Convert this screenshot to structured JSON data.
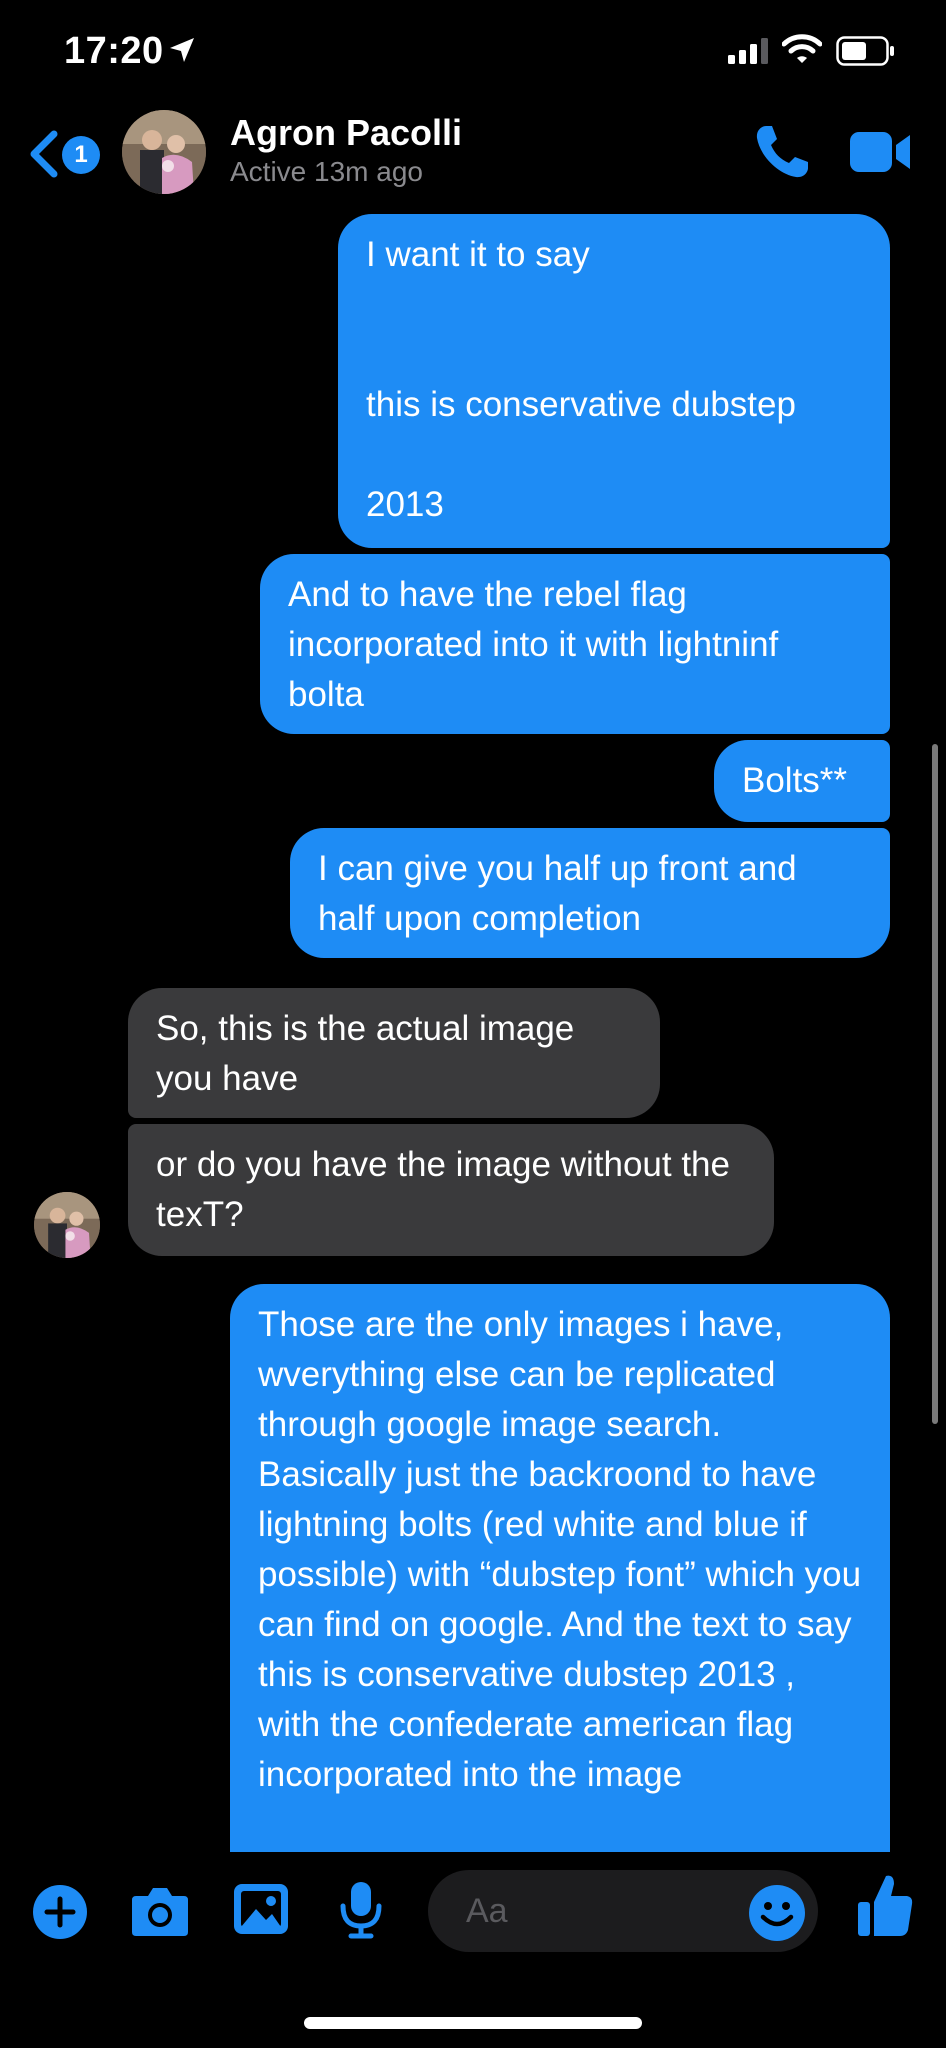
{
  "status_bar": {
    "time": "17:20"
  },
  "header": {
    "unread_badge": "1",
    "contact_name": "Agron Pacolli",
    "contact_status": "Active 13m ago"
  },
  "messages": [
    {
      "from": "me",
      "text": "I want it to say\n\n\nthis is conservative dubstep\n\n2013"
    },
    {
      "from": "me",
      "text": "And to have the rebel flag incorporated into it with lightninf bolta"
    },
    {
      "from": "me",
      "text": "Bolts**"
    },
    {
      "from": "me",
      "text": "I can give you half up front and half upon completion"
    },
    {
      "from": "them",
      "text": "So, this is the actual image you have"
    },
    {
      "from": "them",
      "text": "or do you have the image without the texT?"
    },
    {
      "from": "me",
      "text": "Those are the only images i have, wverything else can be replicated through google image search. Basically just the backroond to have lightning bolts (red white and blue if possible) with “dubstep font” which you can find on google. And the text to say this is conservative dubstep 2013 , with the confederate american flag incorporated into the image"
    }
  ],
  "composer": {
    "placeholder": "Aa"
  },
  "colors": {
    "accent": "#1e8cf5",
    "incoming_bubble": "#3a3a3c",
    "background": "#000000"
  }
}
